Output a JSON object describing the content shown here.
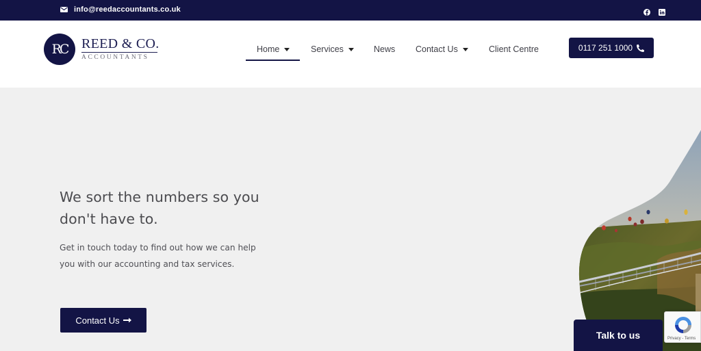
{
  "topbar": {
    "email": "info@reedaccountants.co.uk",
    "social": [
      "facebook-icon",
      "linkedin-icon"
    ]
  },
  "logo": {
    "monogram": "RC",
    "brand": "REED & CO.",
    "subtitle": "ACCOUNTANTS"
  },
  "nav": {
    "items": [
      {
        "label": "Home",
        "has_dropdown": true,
        "active": true
      },
      {
        "label": "Services",
        "has_dropdown": true,
        "active": false
      },
      {
        "label": "News",
        "has_dropdown": false,
        "active": false
      },
      {
        "label": "Contact Us",
        "has_dropdown": true,
        "active": false
      },
      {
        "label": "Client Centre",
        "has_dropdown": false,
        "active": false
      }
    ]
  },
  "phone_button": {
    "label": "0117 251 1000",
    "icon": "phone-icon"
  },
  "hero": {
    "title": "We sort the numbers so you don't have to.",
    "text": "Get in touch today to find out how we can help you with our accounting and tax services.",
    "button_label": "Contact Us"
  },
  "chat": {
    "label": "Talk to us"
  },
  "recaptcha": {
    "terms": "Privacy - Terms"
  },
  "colors": {
    "navy": "#131445",
    "background": "#f0f0f0",
    "text": "#4b4b4f"
  }
}
